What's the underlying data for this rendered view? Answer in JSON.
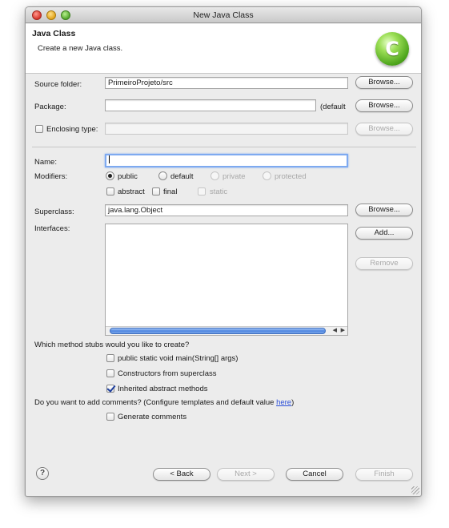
{
  "window": {
    "title": "New Java Class"
  },
  "header": {
    "title": "Java Class",
    "subtitle": "Create a new Java class.",
    "icon": "java-class-wizard-icon"
  },
  "source_folder": {
    "label": "Source folder:",
    "value": "PrimeiroProjeto/src",
    "browse": "Browse..."
  },
  "package": {
    "label": "Package:",
    "value": "",
    "suffix": "(default",
    "browse": "Browse..."
  },
  "enclosing": {
    "label": "Enclosing type:",
    "value": "",
    "browse": "Browse...",
    "checked": false
  },
  "name": {
    "label": "Name:",
    "value": ""
  },
  "modifiers": {
    "label": "Modifiers:",
    "access": [
      "public",
      "default",
      "private",
      "protected"
    ],
    "selected": "public",
    "abstract": "abstract",
    "final": "final",
    "static": "static"
  },
  "superclass": {
    "label": "Superclass:",
    "value": "java.lang.Object",
    "browse": "Browse..."
  },
  "interfaces": {
    "label": "Interfaces:",
    "add": "Add...",
    "remove": "Remove"
  },
  "stubs": {
    "question": "Which method stubs would you like to create?",
    "main": "public static void main(String[] args)",
    "constructors": "Constructors from superclass",
    "inherited": "Inherited abstract methods"
  },
  "comments": {
    "question": "Do you want to add comments? (Configure templates and default value ",
    "link": "here",
    "close": ")",
    "generate": "Generate comments"
  },
  "footer": {
    "back": "< Back",
    "next": "Next >",
    "cancel": "Cancel",
    "finish": "Finish",
    "help": "?"
  }
}
